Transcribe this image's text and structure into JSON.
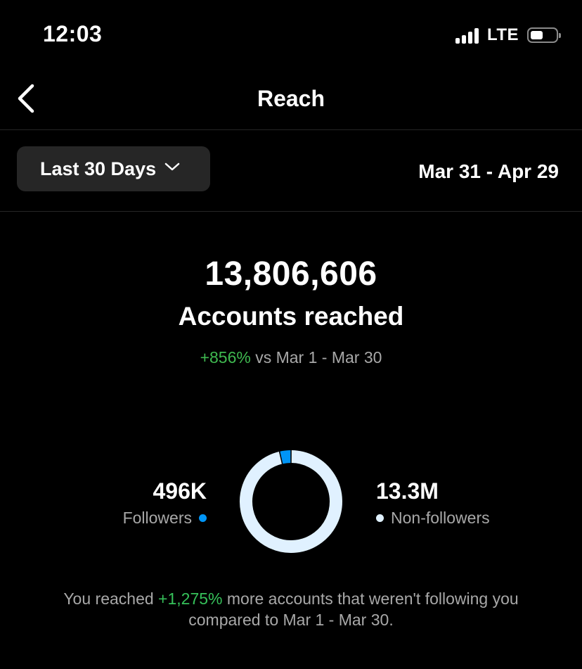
{
  "status_bar": {
    "time": "12:03",
    "network": "LTE",
    "battery_level": 0.5
  },
  "nav": {
    "title": "Reach",
    "back_icon": "chevron-left-icon"
  },
  "filter": {
    "range_label": "Last 30 Days",
    "dropdown_icon": "chevron-down-icon",
    "date_range": "Mar 31 - Apr 29"
  },
  "summary": {
    "total": "13,806,606",
    "label": "Accounts reached",
    "change": "+856%",
    "comparison": "vs Mar 1 - Mar 30"
  },
  "breakdown": {
    "followers": {
      "value": "496K",
      "label": "Followers",
      "color": "#0095f6"
    },
    "non_followers": {
      "value": "13.3M",
      "label": "Non-followers",
      "color": "#e0f1ff"
    }
  },
  "chart_data": {
    "type": "pie",
    "categories": [
      "Followers",
      "Non-followers"
    ],
    "values": [
      496,
      13300
    ],
    "colors": [
      "#0095f6",
      "#e0f1ff"
    ]
  },
  "footer": {
    "prefix": "You reached",
    "change": "+1,275%",
    "suffix": "more accounts that weren't following you compared to Mar 1 - Mar 30."
  },
  "colors": {
    "background": "#000000",
    "positive": "#3fb950",
    "dropdown_bg": "#262626"
  }
}
